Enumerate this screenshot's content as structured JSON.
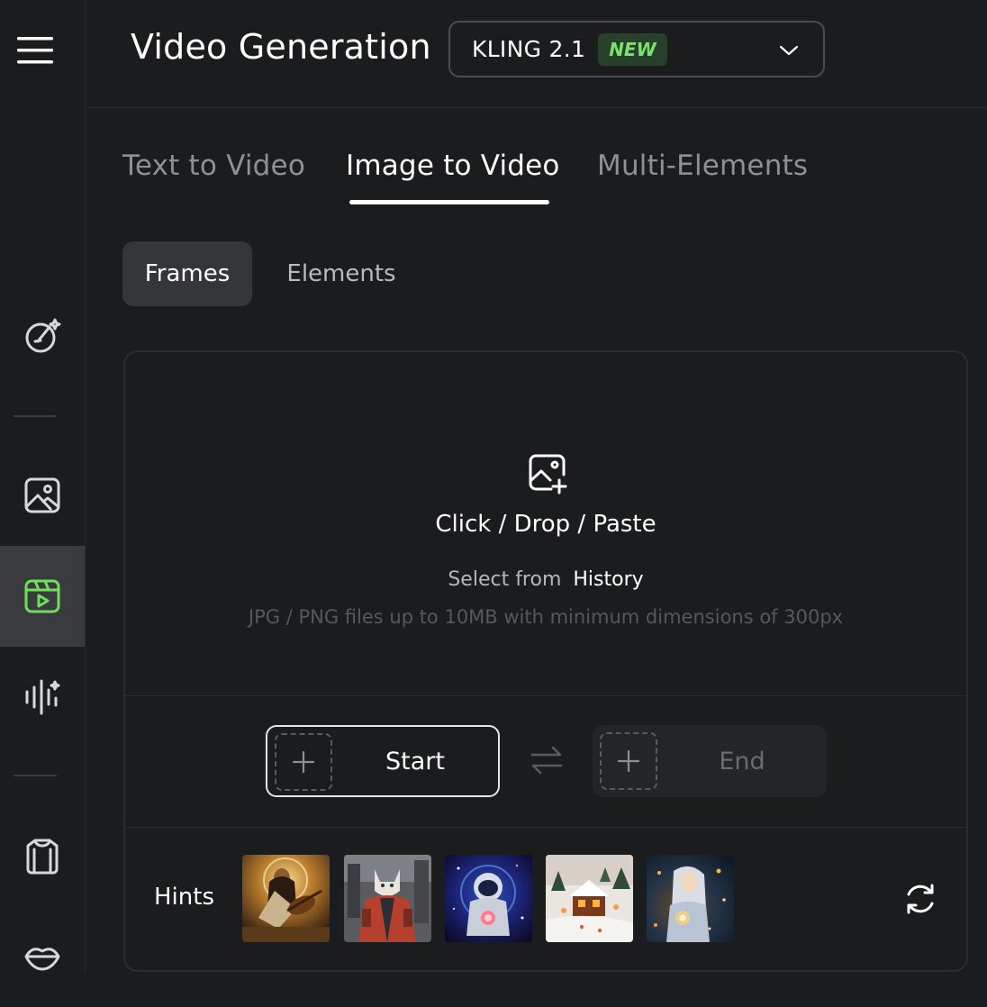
{
  "sidebar": {
    "items": [
      {
        "icon": "menu-icon"
      },
      {
        "icon": "magic-brush-icon"
      },
      {
        "icon": "image-icon"
      },
      {
        "icon": "video-clip-icon",
        "active": true
      },
      {
        "icon": "audio-wave-icon"
      },
      {
        "icon": "shirt-icon"
      },
      {
        "icon": "lips-icon"
      }
    ],
    "active_color": "#6ee05a"
  },
  "header": {
    "title": "Video Generation",
    "model": {
      "name": "KLING 2.1",
      "badge": "NEW"
    }
  },
  "tabs": [
    {
      "label": "Text to Video"
    },
    {
      "label": "Image to Video",
      "active": true
    },
    {
      "label": "Multi-Elements"
    }
  ],
  "subtabs": [
    {
      "label": "Frames",
      "active": true
    },
    {
      "label": "Elements"
    }
  ],
  "upload": {
    "action_text": "Click / Drop / Paste",
    "history_prefix": "Select from",
    "history_link": "History",
    "file_hint": "JPG / PNG files up to 10MB with minimum dimensions of 300px"
  },
  "frames": {
    "start_label": "Start",
    "end_label": "End"
  },
  "hints": {
    "label": "Hints",
    "thumbnails": [
      {
        "subject": "woman-playing-lute"
      },
      {
        "subject": "cat-in-jacket"
      },
      {
        "subject": "astronaut-space"
      },
      {
        "subject": "snowy-cabin"
      },
      {
        "subject": "girl-with-sparks"
      }
    ]
  }
}
